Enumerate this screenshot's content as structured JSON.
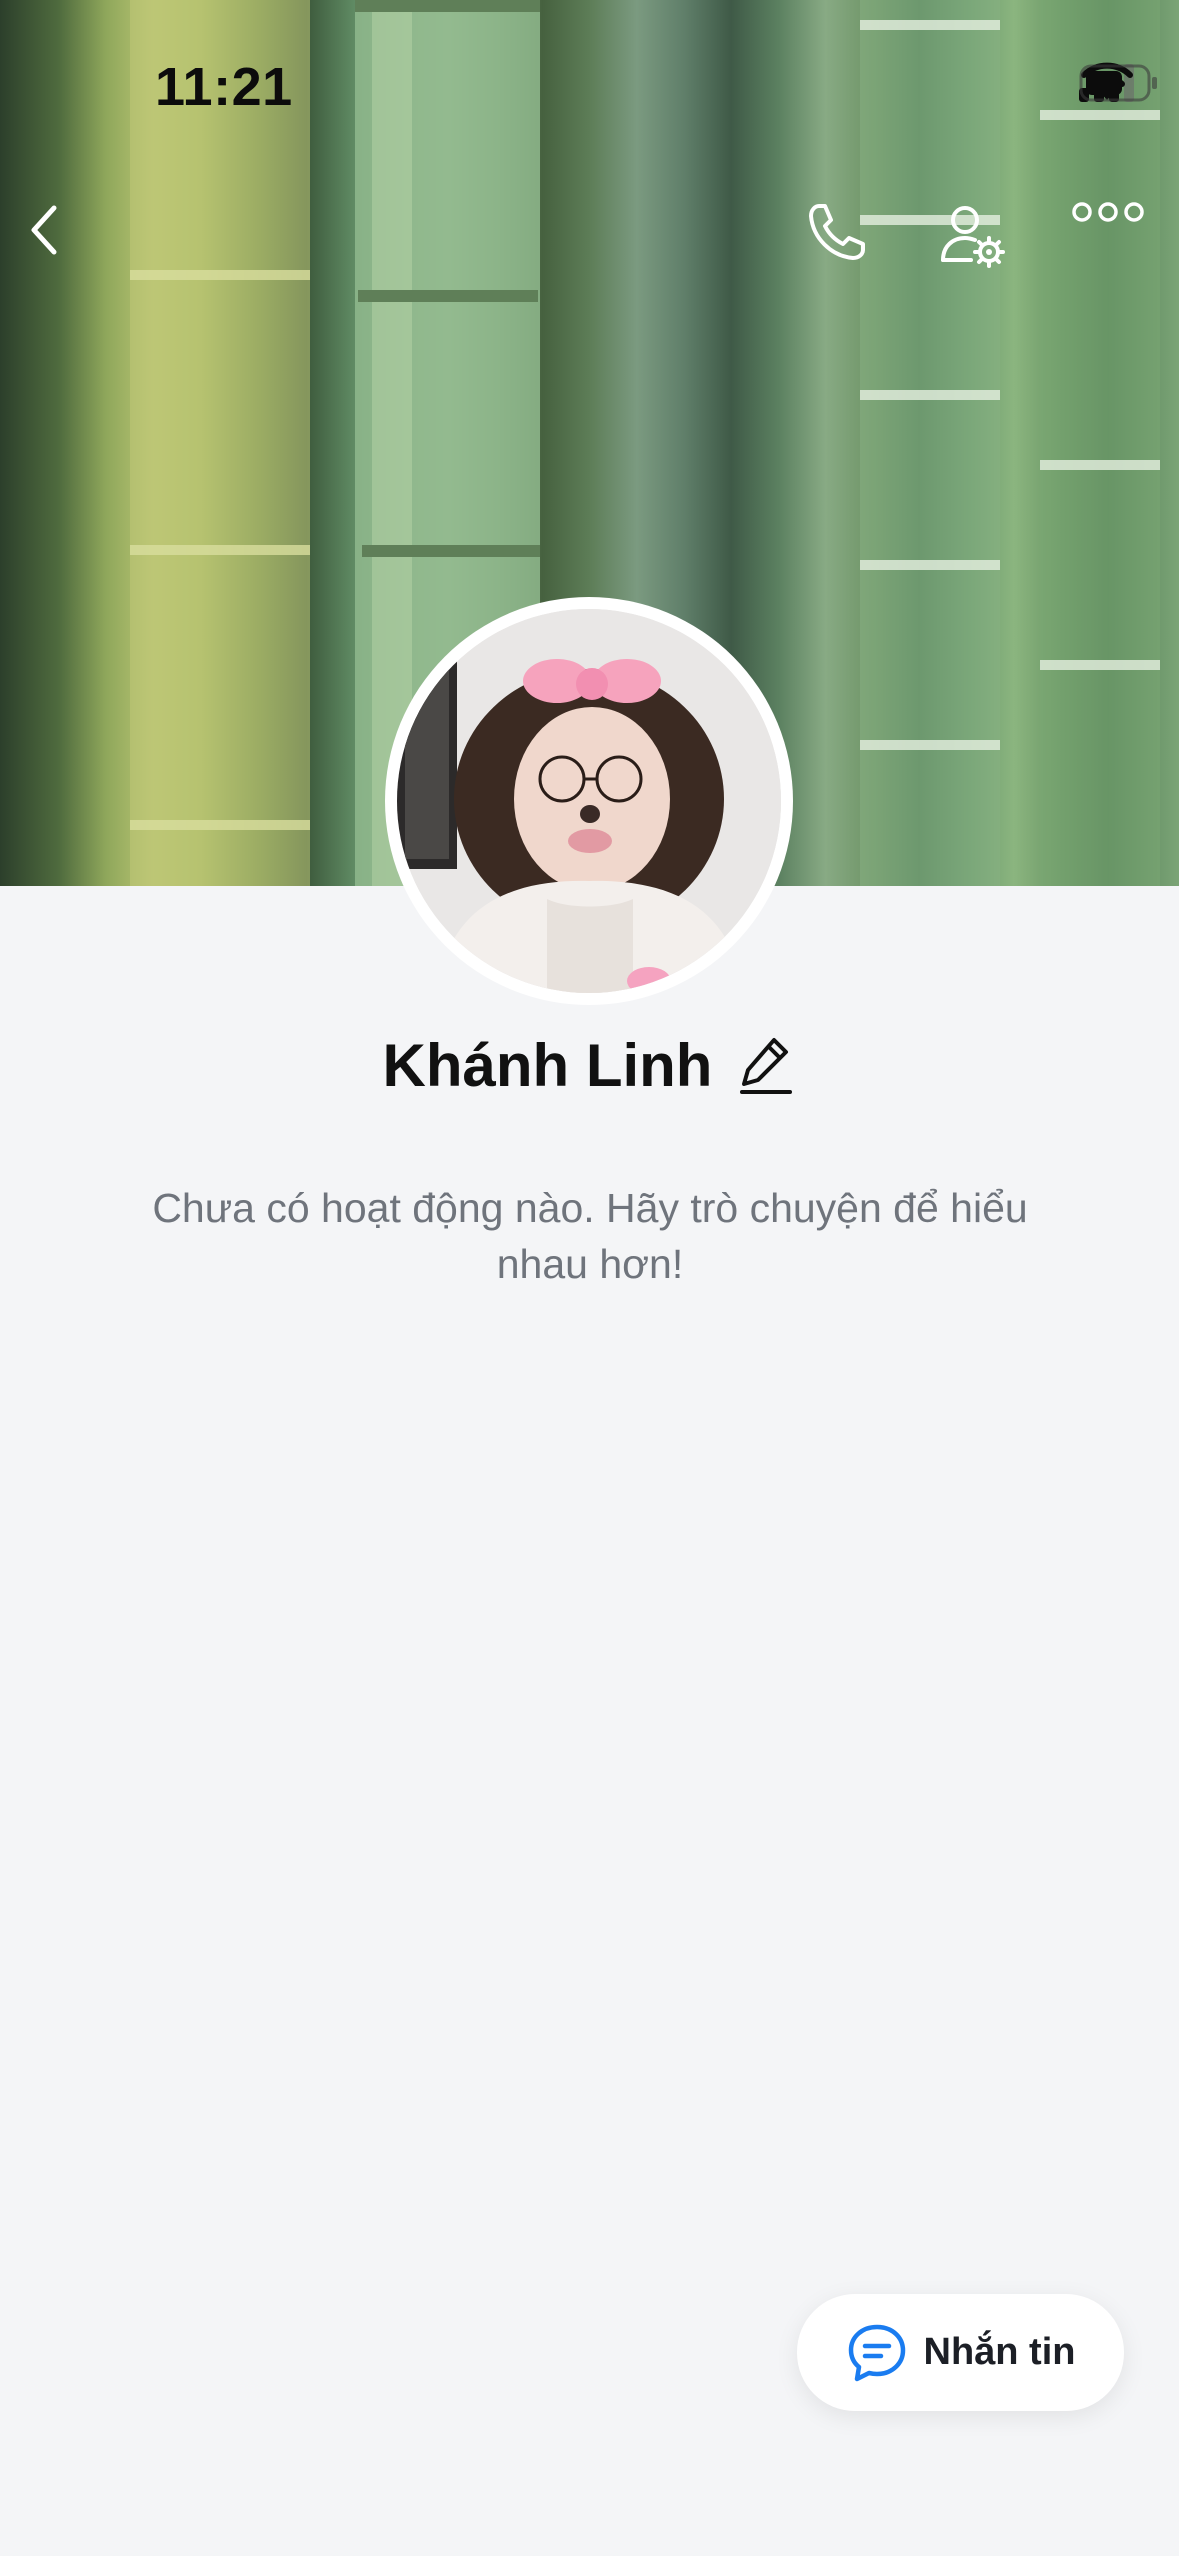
{
  "status_bar": {
    "time": "11:21",
    "icons": [
      "cellular-signal-icon",
      "wifi-icon",
      "battery-icon"
    ]
  },
  "header": {
    "icons": [
      "back-chevron-icon",
      "phone-icon",
      "user-settings-icon",
      "more-dots-icon"
    ]
  },
  "profile": {
    "name": "Khánh Linh",
    "edit_icon": "pencil-icon",
    "empty_message": "Chưa có hoạt động nào. Hãy trò chuyện để hiểu nhau hơn!"
  },
  "message_button": {
    "label": "Nhắn tin",
    "icon": "chat-bubble-icon"
  },
  "colors": {
    "background": "#f4f5f7",
    "accent": "#1a7cf0",
    "text_primary": "#111111",
    "text_secondary": "#6f747c"
  }
}
